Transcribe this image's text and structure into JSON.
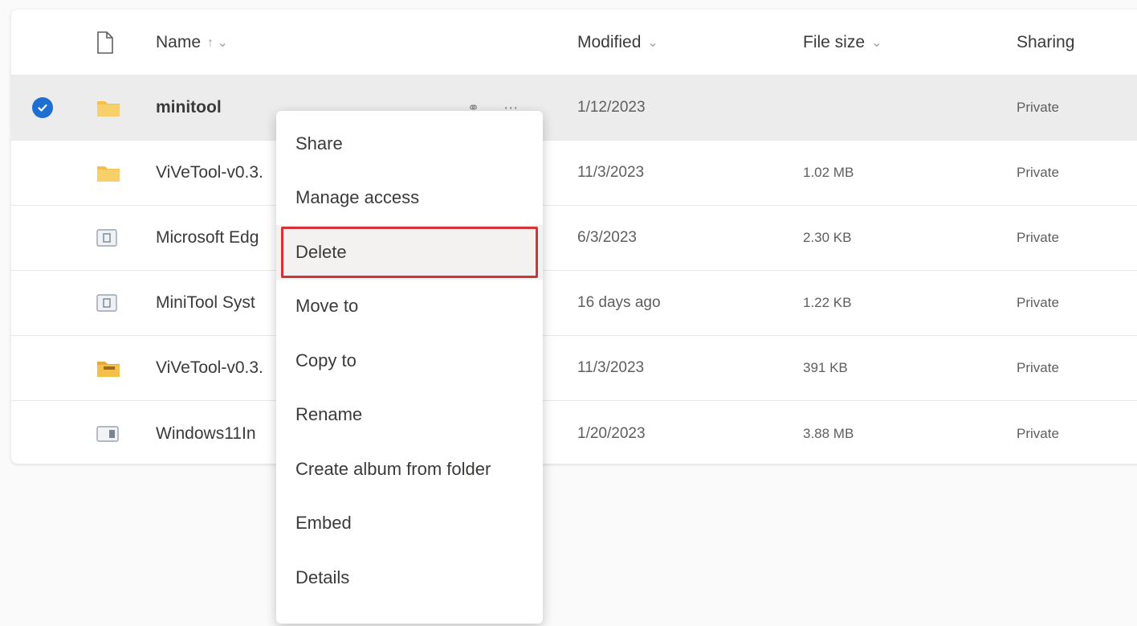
{
  "header": {
    "name": "Name",
    "name_sort": "↑ ⌄",
    "modified": "Modified",
    "modified_sort": "⌄",
    "file_size": "File size",
    "file_size_sort": "⌄",
    "sharing": "Sharing"
  },
  "rows": [
    {
      "name": "minitool",
      "modified": "1/12/2023",
      "size": "",
      "sharing": "Private",
      "icon": "folder-icon"
    },
    {
      "name": "ViVeTool-v0.3.",
      "modified": "11/3/2023",
      "size": "1.02 MB",
      "sharing": "Private",
      "icon": "folder-icon"
    },
    {
      "name": "Microsoft Edg",
      "modified": "6/3/2023",
      "size": "2.30 KB",
      "sharing": "Private",
      "icon": "file-icon"
    },
    {
      "name": "MiniTool Syst",
      "modified": "16 days ago",
      "size": "1.22 KB",
      "sharing": "Private",
      "icon": "file-icon"
    },
    {
      "name": "ViVeTool-v0.3.",
      "modified": "11/3/2023",
      "size": "391 KB",
      "sharing": "Private",
      "icon": "zip-folder-icon"
    },
    {
      "name": "Windows11In",
      "modified": "1/20/2023",
      "size": "3.88 MB",
      "sharing": "Private",
      "icon": "image-file-icon"
    }
  ],
  "context_menu": {
    "items": [
      "Share",
      "Manage access",
      "Delete",
      "Move to",
      "Copy to",
      "Rename",
      "Create album from folder",
      "Embed",
      "Details"
    ],
    "highlighted": "Delete"
  },
  "colors": {
    "accent": "#1f6fd1",
    "folder": "#f5c04a",
    "highlight_border": "#d13438"
  }
}
